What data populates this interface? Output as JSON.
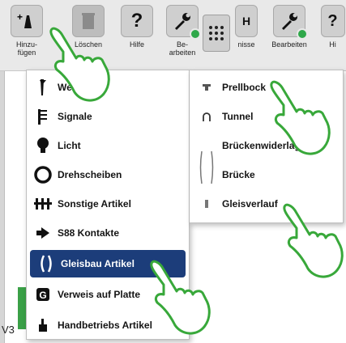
{
  "toolbar": {
    "add_label": "Hinzu-\nfügen",
    "delete_label": "Löschen",
    "help_label": "Hilfe",
    "edit_label": "Be-\narbeiten",
    "results_label": "nisse",
    "edit2_label": "Bearbeiten",
    "h_label": "Hi"
  },
  "add_menu": {
    "items": [
      {
        "label": "Weichen",
        "icon": "turnout-icon"
      },
      {
        "label": "Signale",
        "icon": "signal-icon"
      },
      {
        "label": "Licht",
        "icon": "light-bulb-icon"
      },
      {
        "label": "Drehscheiben",
        "icon": "turntable-icon"
      },
      {
        "label": "Sonstige Artikel",
        "icon": "misc-articles-icon"
      },
      {
        "label": "S88 Kontakte",
        "icon": "s88-contact-icon"
      },
      {
        "label": "Gleisbau Artikel",
        "icon": "track-construction-icon"
      },
      {
        "label": "Verweis auf Platte",
        "icon": "plate-reference-icon"
      },
      {
        "label": "Handbetriebs Artikel",
        "icon": "manual-operation-icon"
      }
    ],
    "selected": "Gleisbau Artikel"
  },
  "submenu": {
    "items": [
      {
        "label": "Prellbock",
        "icon": "buffer-stop-icon"
      },
      {
        "label": "Tunnel",
        "icon": "tunnel-icon"
      },
      {
        "label": "Brückenwiderlager",
        "icon": "bridge-abutment-icon"
      },
      {
        "label": "Brücke",
        "icon": "bridge-icon"
      },
      {
        "label": "Gleisverlauf",
        "icon": "track-course-icon"
      }
    ]
  },
  "background": {
    "partial_text": "V3"
  },
  "colors": {
    "selected_bg": "#1c3d7a",
    "hand_outline": "#38a83a",
    "check_green": "#2fa84a"
  }
}
